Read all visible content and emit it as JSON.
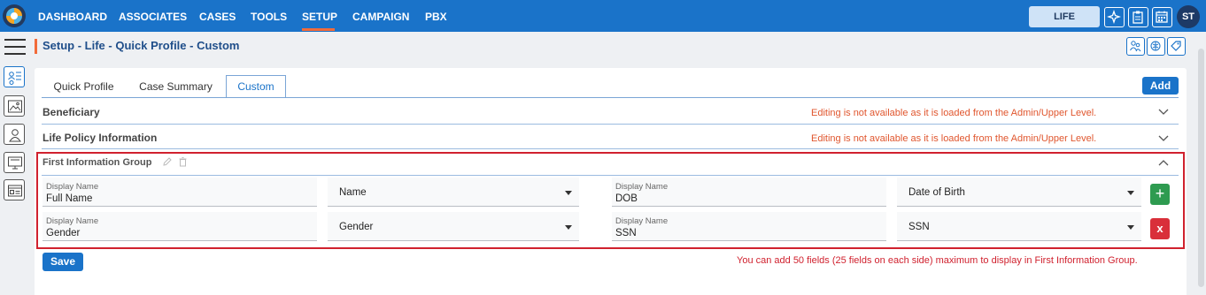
{
  "nav": {
    "items": [
      "DASHBOARD",
      "ASSOCIATES",
      "CASES",
      "TOOLS",
      "SETUP",
      "CAMPAIGN",
      "PBX"
    ],
    "active": "SETUP",
    "life_badge": "LIFE",
    "avatar_initials": "ST",
    "accent_color": "#1a73c9",
    "active_underline_color": "#f26b3a"
  },
  "page": {
    "title": "Setup - Life - Quick Profile - Custom"
  },
  "tabs": [
    {
      "label": "Quick Profile"
    },
    {
      "label": "Case Summary"
    },
    {
      "label": "Custom"
    }
  ],
  "active_tab": "Custom",
  "add_label": "Add",
  "sections": [
    {
      "title": "Beneficiary",
      "note": "Editing is not available as it is loaded from the Admin/Upper Level."
    },
    {
      "title": "Life Policy Information",
      "note": "Editing is not available as it is loaded from the Admin/Upper Level."
    }
  ],
  "group": {
    "title": "First Information Group",
    "rows": [
      {
        "left": {
          "label": "Display Name",
          "value": "Full Name",
          "select": "Name"
        },
        "right": {
          "label": "Display Name",
          "value": "DOB",
          "select": "Date of Birth"
        }
      },
      {
        "left": {
          "label": "Display Name",
          "value": "Gender",
          "select": "Gender"
        },
        "right": {
          "label": "Display Name",
          "value": "SSN",
          "select": "SSN"
        }
      }
    ],
    "add_symbol": "+",
    "remove_symbol": "x"
  },
  "save_label": "Save",
  "limit_note": "You can add 50 fields (25 fields on each side) maximum to display in First Information Group."
}
